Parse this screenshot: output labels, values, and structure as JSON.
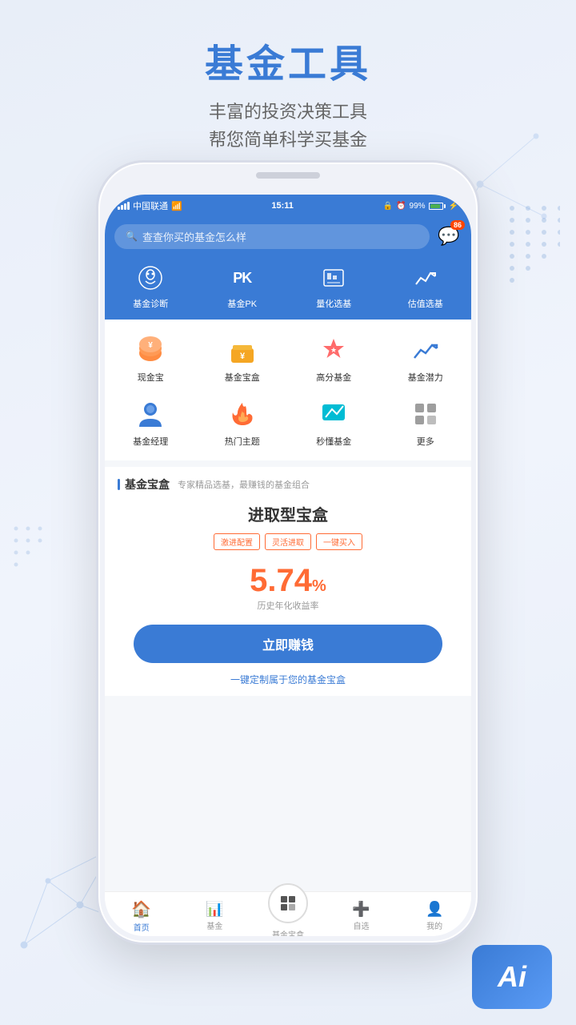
{
  "page": {
    "title": "基金工具",
    "subtitle_line1": "丰富的投资决策工具",
    "subtitle_line2": "帮您简单科学买基金"
  },
  "status_bar": {
    "carrier": "中国联通",
    "time": "15:11",
    "battery": "99%"
  },
  "search": {
    "placeholder": "查查你买的基金怎么样",
    "message_badge": "86"
  },
  "tool_nav": [
    {
      "id": "diagnosis",
      "icon": "🧠",
      "label": "基金诊断"
    },
    {
      "id": "pk",
      "label_icon": "PK",
      "label": "基金PK"
    },
    {
      "id": "quant",
      "label": "量化选基"
    },
    {
      "id": "value",
      "label": "估值选基"
    }
  ],
  "grid_menu": {
    "rows": [
      [
        {
          "id": "cash",
          "icon": "🐷",
          "color": "#ff8c42",
          "label": "现金宝"
        },
        {
          "id": "box",
          "icon": "💰",
          "color": "#f5a623",
          "label": "基金宝盒"
        },
        {
          "id": "highscore",
          "icon": "⭐",
          "color": "#ff6b6b",
          "label": "高分基金"
        },
        {
          "id": "potential",
          "icon": "📈",
          "color": "#3a7bd5",
          "label": "基金潜力"
        }
      ],
      [
        {
          "id": "manager",
          "icon": "👤",
          "color": "#3a7bd5",
          "label": "基金经理"
        },
        {
          "id": "hot",
          "icon": "🔥",
          "color": "#ff6b35",
          "label": "热门主题"
        },
        {
          "id": "understand",
          "icon": "⚡",
          "color": "#00bcd4",
          "label": "秒懂基金"
        },
        {
          "id": "more",
          "icon": "⊞",
          "color": "#9e9e9e",
          "label": "更多"
        }
      ]
    ]
  },
  "fund_box": {
    "section_title": "基金宝盒",
    "section_desc": "专家精品选基，最赚钱的基金组合",
    "product_name": "进取型宝盒",
    "tags": [
      "激进配置",
      "灵活进取",
      "一键买入"
    ],
    "yield_number": "5.74",
    "yield_unit": "%",
    "yield_desc": "历史年化收益率",
    "earn_button": "立即赚钱",
    "customize_link": "一键定制属于您的基金宝盒"
  },
  "tab_bar": {
    "items": [
      {
        "id": "home",
        "icon": "🏠",
        "label": "首页",
        "active": true
      },
      {
        "id": "fund",
        "icon": "📊",
        "label": "基金",
        "active": false
      },
      {
        "id": "fundbox",
        "icon": "🗂",
        "label": "基金宝盒",
        "active": false,
        "center": true
      },
      {
        "id": "watchlist",
        "icon": "➕",
        "label": "自选",
        "active": false
      },
      {
        "id": "mine",
        "icon": "👤",
        "label": "我的",
        "active": false
      }
    ]
  },
  "ai_badge": {
    "text": "Ai"
  }
}
